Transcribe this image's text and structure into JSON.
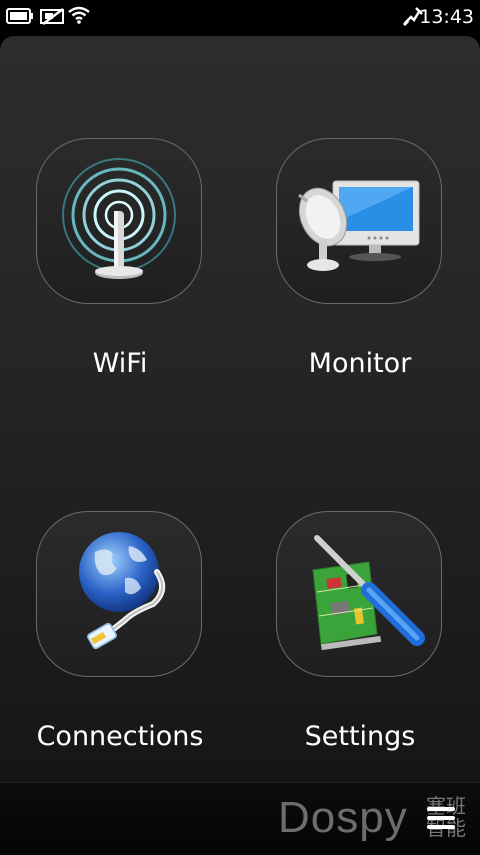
{
  "status": {
    "time": "13:43",
    "icons": [
      "battery-icon",
      "no-sim-icon",
      "wifi-signal-icon",
      "usb-connection-icon"
    ]
  },
  "grid": {
    "items": [
      {
        "label": "WiFi",
        "icon": "wifi-antenna-icon"
      },
      {
        "label": "Monitor",
        "icon": "monitor-icon"
      },
      {
        "label": "Connections",
        "icon": "globe-network-icon"
      },
      {
        "label": "Settings",
        "icon": "settings-tools-icon"
      }
    ]
  },
  "bottom": {
    "watermark": "Dospy",
    "watermark_cn": "塞班 智能"
  }
}
